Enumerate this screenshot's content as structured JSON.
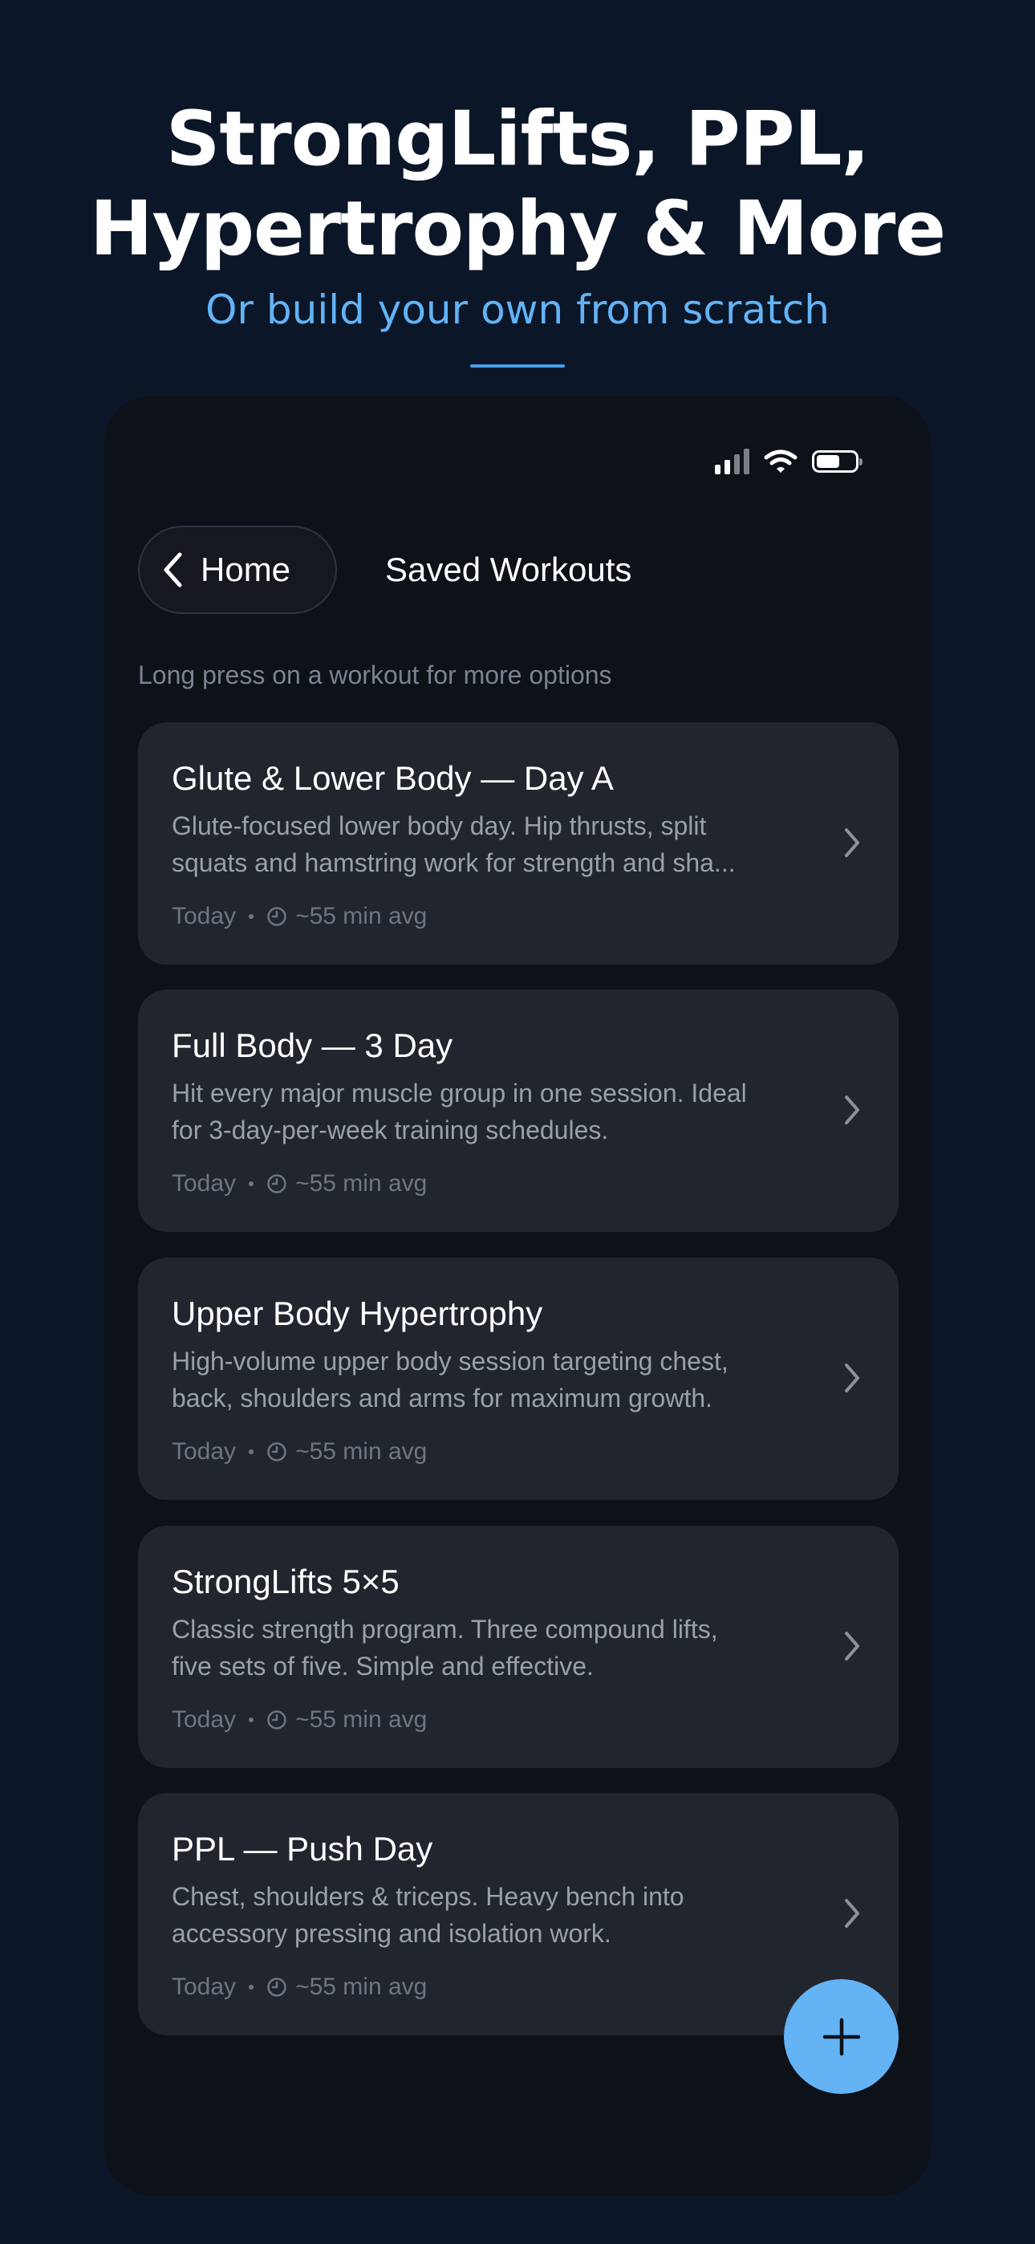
{
  "hero": {
    "title_line1": "StrongLifts, PPL,",
    "title_line2": "Hypertrophy & More",
    "subtitle": "Or build your own from scratch"
  },
  "nav": {
    "back_label": "Home",
    "title": "Saved Workouts"
  },
  "hint": "Long press on a workout for more options",
  "workouts": [
    {
      "title": "Glute & Lower Body — Day A",
      "desc_line1": "Glute-focused lower body day. Hip thrusts, split",
      "desc_line2": "squats and hamstring work for strength and sha...",
      "date": "Today",
      "duration": "~55 min avg"
    },
    {
      "title": "Full Body — 3 Day",
      "desc_line1": "Hit every major muscle group in one session. Ideal",
      "desc_line2": "for 3-day-per-week training schedules.",
      "date": "Today",
      "duration": "~55 min avg"
    },
    {
      "title": "Upper Body Hypertrophy",
      "desc_line1": "High-volume upper body session targeting chest,",
      "desc_line2": "back, shoulders and arms for maximum growth.",
      "date": "Today",
      "duration": "~55 min avg"
    },
    {
      "title": "StrongLifts 5×5",
      "desc_line1": "Classic strength program. Three compound lifts,",
      "desc_line2": "five sets of five. Simple and effective.",
      "date": "Today",
      "duration": "~55 min avg"
    },
    {
      "title": "PPL — Push Day",
      "desc_line1": "Chest, shoulders & triceps. Heavy bench into",
      "desc_line2": "accessory pressing and isolation work.",
      "date": "Today",
      "duration": "~55 min avg"
    }
  ],
  "colors": {
    "background": "#0b1628",
    "phone_background": "#0d1118",
    "card_background": "#21252d",
    "accent": "#63b3f5"
  },
  "icons": {
    "back": "chevron-left-icon",
    "row_action": "chevron-right-icon",
    "duration": "clock-icon",
    "fab": "plus-icon"
  }
}
